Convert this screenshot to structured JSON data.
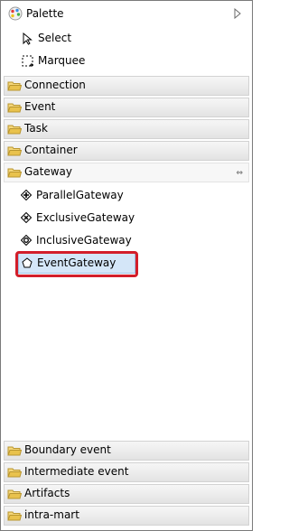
{
  "palette": {
    "title": "Palette"
  },
  "tools": [
    {
      "label": "Select",
      "icon": "cursor-arrow-icon"
    },
    {
      "label": "Marquee",
      "icon": "marquee-icon"
    }
  ],
  "drawers_top": [
    {
      "label": "Connection"
    },
    {
      "label": "Event"
    },
    {
      "label": "Task"
    },
    {
      "label": "Container"
    }
  ],
  "gateway": {
    "label": "Gateway",
    "entries": [
      {
        "label": "ParallelGateway",
        "icon": "parallel-gateway-icon"
      },
      {
        "label": "ExclusiveGateway",
        "icon": "exclusive-gateway-icon"
      },
      {
        "label": "InclusiveGateway",
        "icon": "inclusive-gateway-icon"
      },
      {
        "label": "EventGateway",
        "icon": "event-gateway-icon",
        "selected": true
      }
    ]
  },
  "drawers_bottom": [
    {
      "label": "Boundary event"
    },
    {
      "label": "Intermediate event"
    },
    {
      "label": "Artifacts"
    },
    {
      "label": "intra-mart"
    }
  ],
  "colors": {
    "highlight": "#d31e2a",
    "selection": "#d4e6f8",
    "folder": "#e9c24d"
  }
}
